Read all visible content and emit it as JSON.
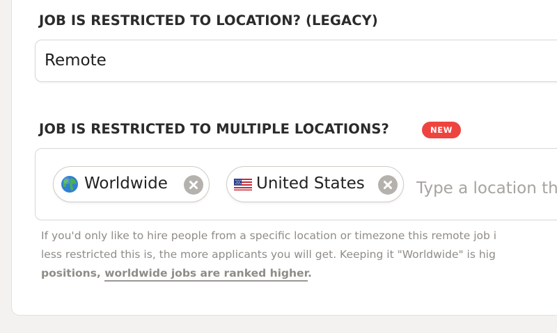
{
  "legacy": {
    "label": "JOB IS RESTRICTED TO LOCATION? (LEGACY)",
    "value": "Remote"
  },
  "multi": {
    "label": "JOB IS RESTRICTED TO MULTIPLE LOCATIONS?",
    "badge": "NEW",
    "badge_color": "#ee4440",
    "chips": [
      {
        "icon": "globe-icon",
        "label": "Worldwide"
      },
      {
        "icon": "us-flag-icon",
        "label": "United States"
      }
    ],
    "placeholder": "Type a location th"
  },
  "help": {
    "line1": "If you'd only like to hire people from a specific location or timezone this remote job i",
    "line2": "less restricted this is, the more applicants you will get. Keeping it \"Worldwide\" is hig",
    "line3_bold": "positions, ",
    "line3_link": "worldwide jobs are ranked higher",
    "line3_end": "."
  }
}
